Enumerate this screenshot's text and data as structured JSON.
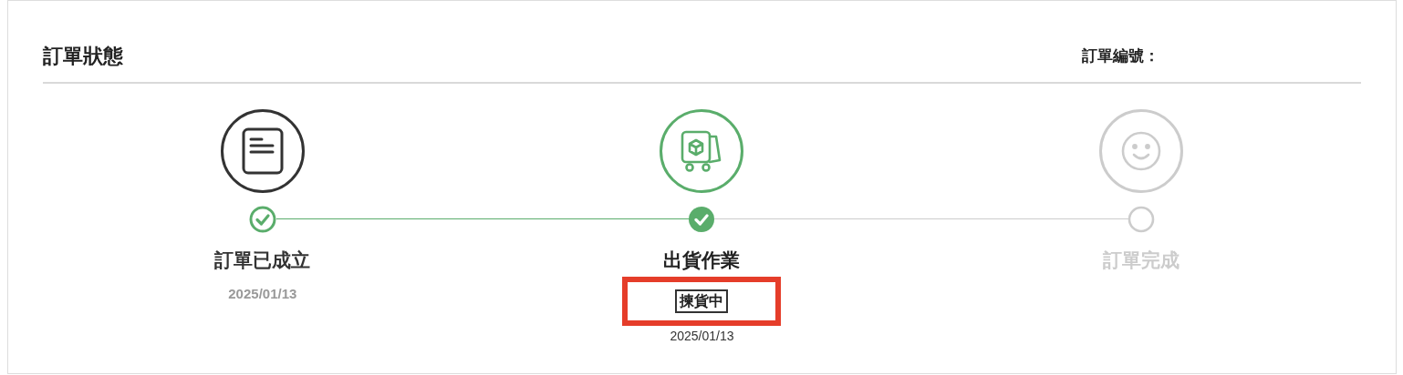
{
  "title": "訂單狀態",
  "order_number_label": "訂單編號：",
  "steps": [
    {
      "kind": "document",
      "reached": true,
      "current": false,
      "label": "訂單已成立",
      "date": "2025/01/13"
    },
    {
      "kind": "shipping",
      "reached": true,
      "current": true,
      "label": "出貨作業",
      "sub_status": {
        "text": "揀貨中",
        "highlighted": true
      },
      "date": "2025/01/13"
    },
    {
      "kind": "complete",
      "reached": false,
      "current": false,
      "label": "訂單完成"
    }
  ]
}
